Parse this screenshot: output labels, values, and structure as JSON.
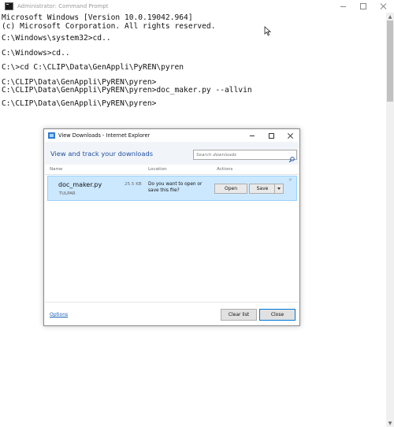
{
  "cmd_window": {
    "title": "Administrator: Command Prompt",
    "lines": [
      "Microsoft Windows [Version 10.0.19042.964]",
      "(c) Microsoft Corporation. All rights reserved.",
      "",
      "C:\\Windows\\system32>cd..",
      "",
      "C:\\Windows>cd..",
      "",
      "C:\\>cd C:\\CLIP\\Data\\GenAppli\\PyREN\\pyren",
      "",
      "C:\\CLIP\\Data\\GenAppli\\PyREN\\pyren>",
      "C:\\CLIP\\Data\\GenAppli\\PyREN\\pyren>doc_maker.py --allvin",
      "",
      "C:\\CLIP\\Data\\GenAppli\\PyREN\\pyren>"
    ]
  },
  "download_dialog": {
    "title": "View Downloads - Internet Explorer",
    "heading": "View and track your downloads",
    "search_placeholder": "Search downloads",
    "columns": {
      "name": "Name",
      "location": "Location",
      "actions": "Actions"
    },
    "item": {
      "file_name": "doc_maker.py",
      "source": "TULPAR",
      "size": "25.5 KB",
      "prompt": "Do you want to open or save this file?",
      "open_label": "Open",
      "save_label": "Save"
    },
    "options_label": "Options",
    "clear_list_label": "Clear list",
    "close_label": "Close"
  }
}
